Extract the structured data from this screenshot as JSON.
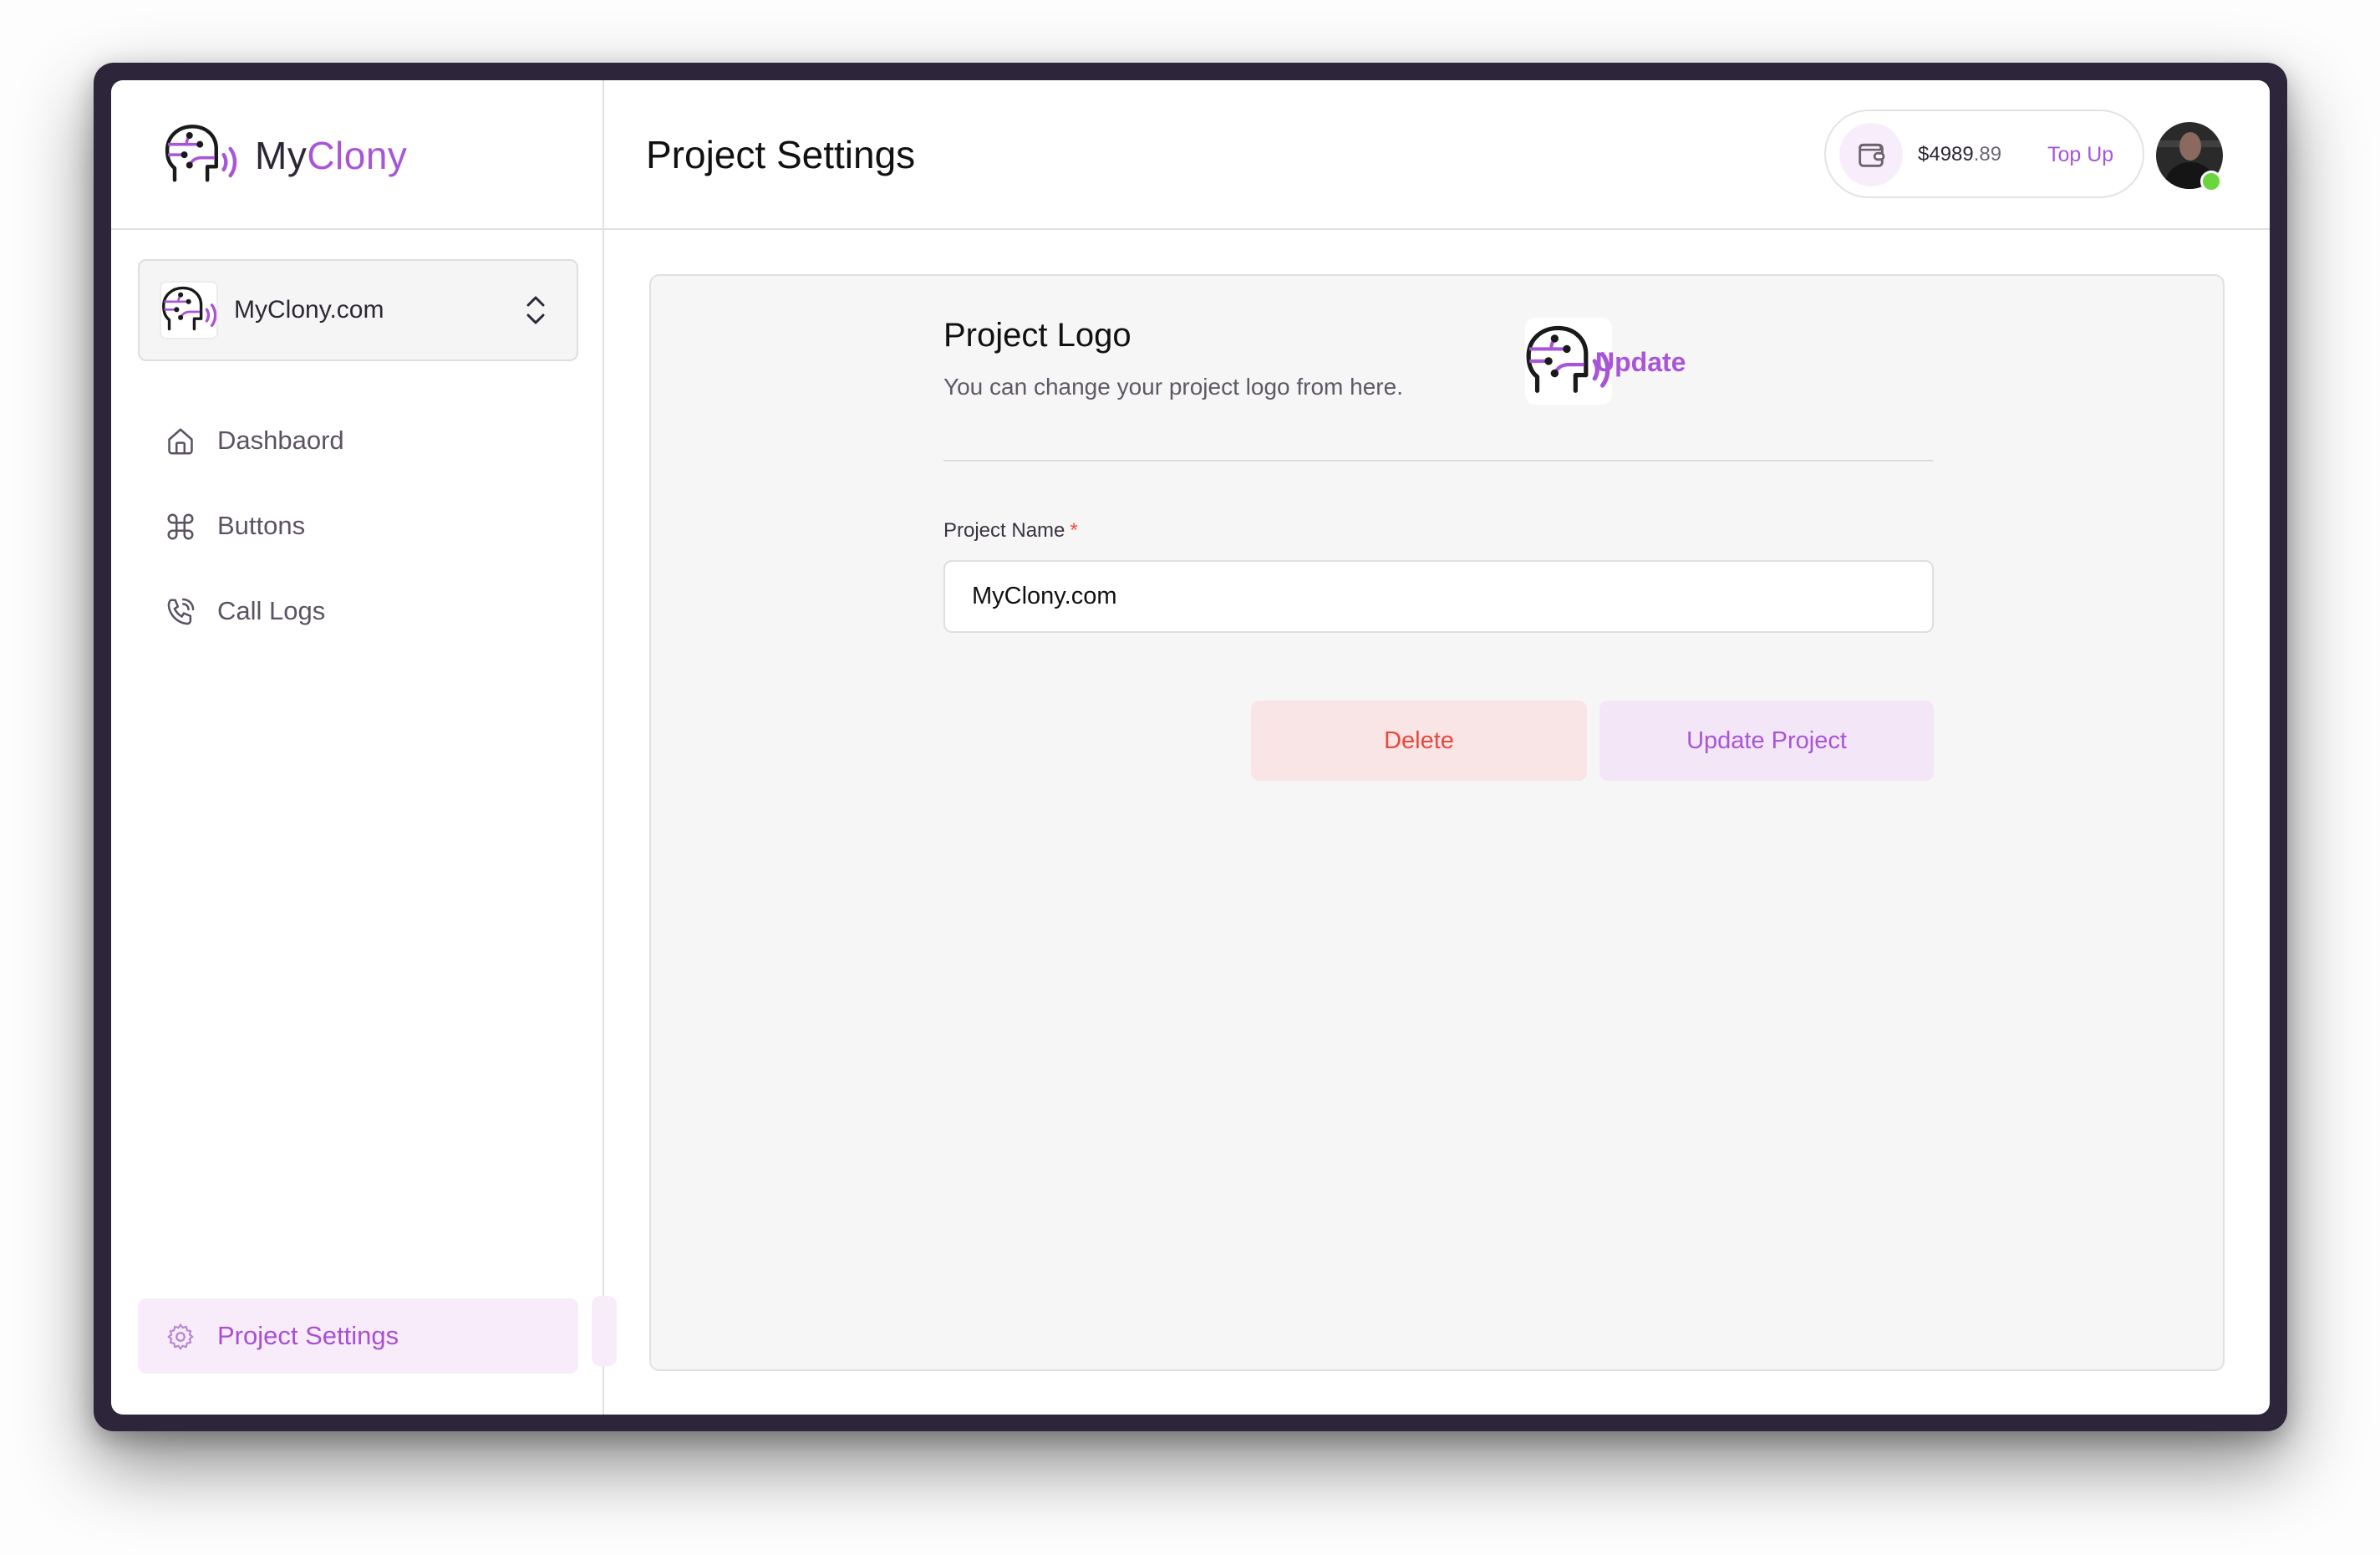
{
  "app": {
    "brand_prefix": "My",
    "brand_suffix": "Clony",
    "accent_color": "#a855d8"
  },
  "sidebar": {
    "project_switcher": {
      "name": "MyClony.com",
      "icon": "chevron-up-down-icon"
    },
    "items": [
      {
        "label": "Dashbaord",
        "icon": "home-icon",
        "active": false
      },
      {
        "label": "Buttons",
        "icon": "command-icon",
        "active": false
      },
      {
        "label": "Call Logs",
        "icon": "phone-call-icon",
        "active": false
      }
    ],
    "bottom_item": {
      "label": "Project Settings",
      "icon": "gear-icon",
      "active": true
    }
  },
  "header": {
    "title": "Project Settings",
    "wallet": {
      "icon": "wallet-icon",
      "balance_main": "$4989",
      "balance_cents": ".89",
      "topup_label": "Top Up"
    },
    "user": {
      "avatar": "user-avatar",
      "status": "online",
      "status_color": "#6ad63c"
    }
  },
  "main": {
    "logo_section": {
      "title": "Project Logo",
      "description": "You can change your project logo from here.",
      "update_label": "Update"
    },
    "form": {
      "project_name_label": "Project Name",
      "required_marker": "*",
      "project_name_value": "MyClony.com"
    },
    "actions": {
      "delete_label": "Delete",
      "update_label": "Update Project",
      "delete_color": "#e8473d"
    }
  }
}
